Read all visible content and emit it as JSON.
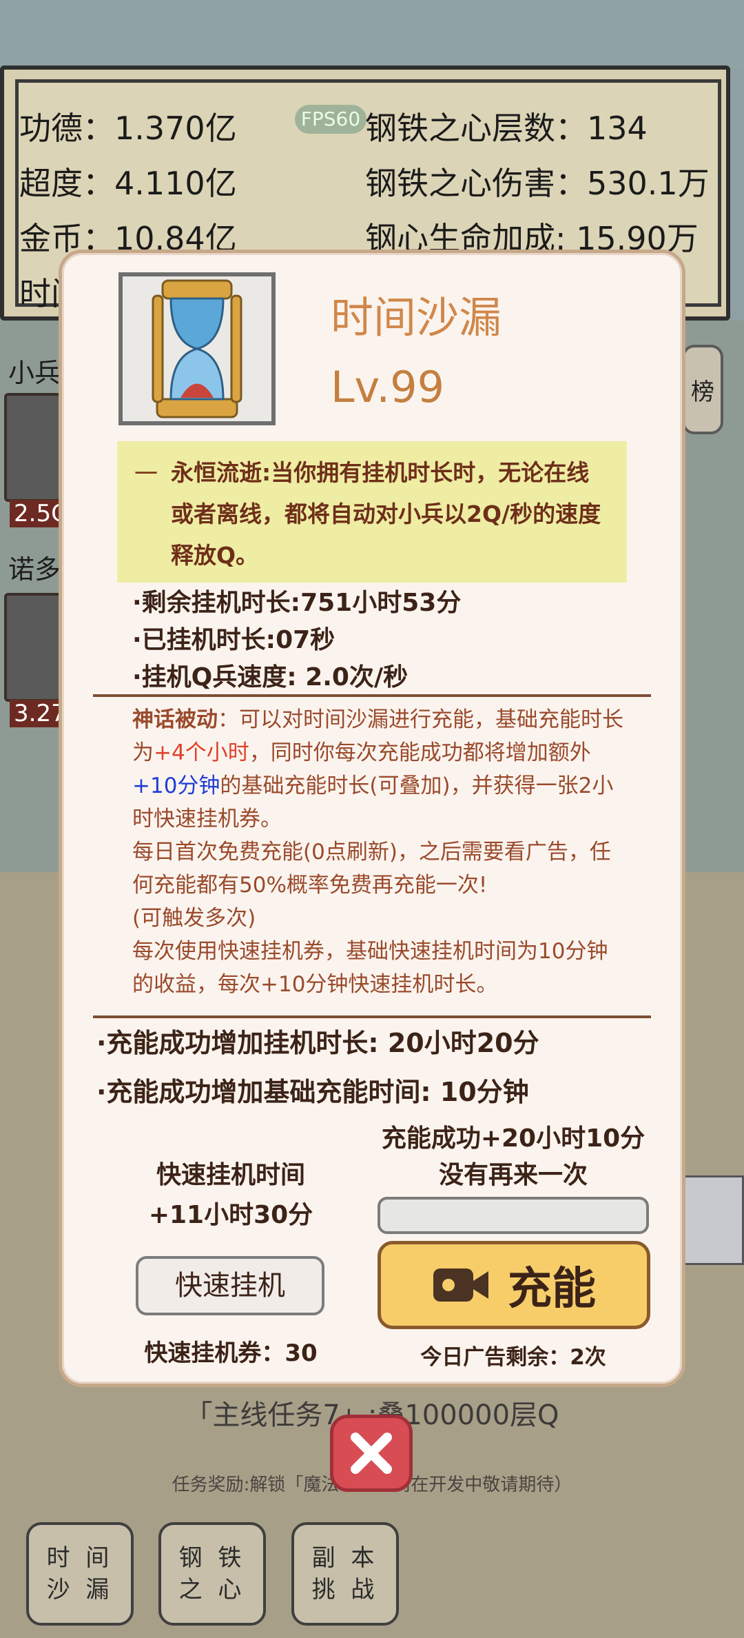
{
  "stats": {
    "merit": "功德：1.370亿",
    "transcend": "超度：4.110亿",
    "gold": "金币：10.84亿",
    "time_partial": "时间",
    "fps": "FPS60",
    "steel_layers": "钢铁之心层数：134",
    "steel_damage": "钢铁之心伤害：530.1万",
    "steel_hp": "钢心生命加成: 15.90万"
  },
  "background": {
    "soldier_label": "小兵",
    "soldier_value": "2.5C",
    "nuo_label": "诺多",
    "nuo_value": "3.27",
    "rank_button": "榜",
    "task_title": "「主线任务7」:叠100000层Q",
    "task_reward": "任务奖励:解锁「魔法系……尚在开发中敬请期待）",
    "nav": [
      {
        "label": "时 间\n沙 漏"
      },
      {
        "label": "钢 铁\n之 心"
      },
      {
        "label": "副 本\n挑 战"
      }
    ]
  },
  "modal": {
    "title": "时间沙漏",
    "level": "Lv.99",
    "desc_dash": "一",
    "desc": "永恒流逝:当你拥有挂机时长时，无论在线或者离线，都将自动对小兵以2Q/秒的速度释放Q。",
    "remaining": "·剩余挂机时长:751小时53分",
    "elapsed": "·已挂机时长:07秒",
    "speed": "·挂机Q兵速度: 2.0次/秒",
    "passive": {
      "label": "神话被动",
      "p1": "：可以对时间沙漏进行充能，基础充能时长为",
      "p1_red": "+4个小时",
      "p2": "，同时你每次充能成功都将增加额外",
      "p2_blue": "+10分钟",
      "p3": "的基础充能时长(可叠加)，并获得一张2小时快速挂机券。",
      "p4": "每日首次免费充能(0点刷新)，之后需要看广告，任何充能都有50%概率免费再充能一次!",
      "p5": "(可触发多次)",
      "p6": "每次使用快速挂机券，基础快速挂机时间为10分钟的收益，每次+10分钟快速挂机时长。"
    },
    "charge_add_time": "·充能成功增加挂机时长: 20小时20分",
    "charge_add_base": "·充能成功增加基础充能时间: 10分钟",
    "quick_time_label": "快速挂机时间",
    "quick_time_value": "+11小时30分",
    "charge_result_1": "充能成功+20小时10分",
    "charge_result_2": "没有再来一次",
    "quick_button": "快速挂机",
    "charge_button": "充能",
    "quick_tickets": "快速挂机券：30",
    "ads_left": "今日广告剩余：2次"
  },
  "colors": {
    "accent_title": "#d0874a",
    "desc_bg": "#eeeda3",
    "charge_button": "#f7cd6a",
    "close_button": "#d84c54"
  },
  "icons": [
    "hourglass-icon",
    "video-camera-icon",
    "close-icon"
  ]
}
